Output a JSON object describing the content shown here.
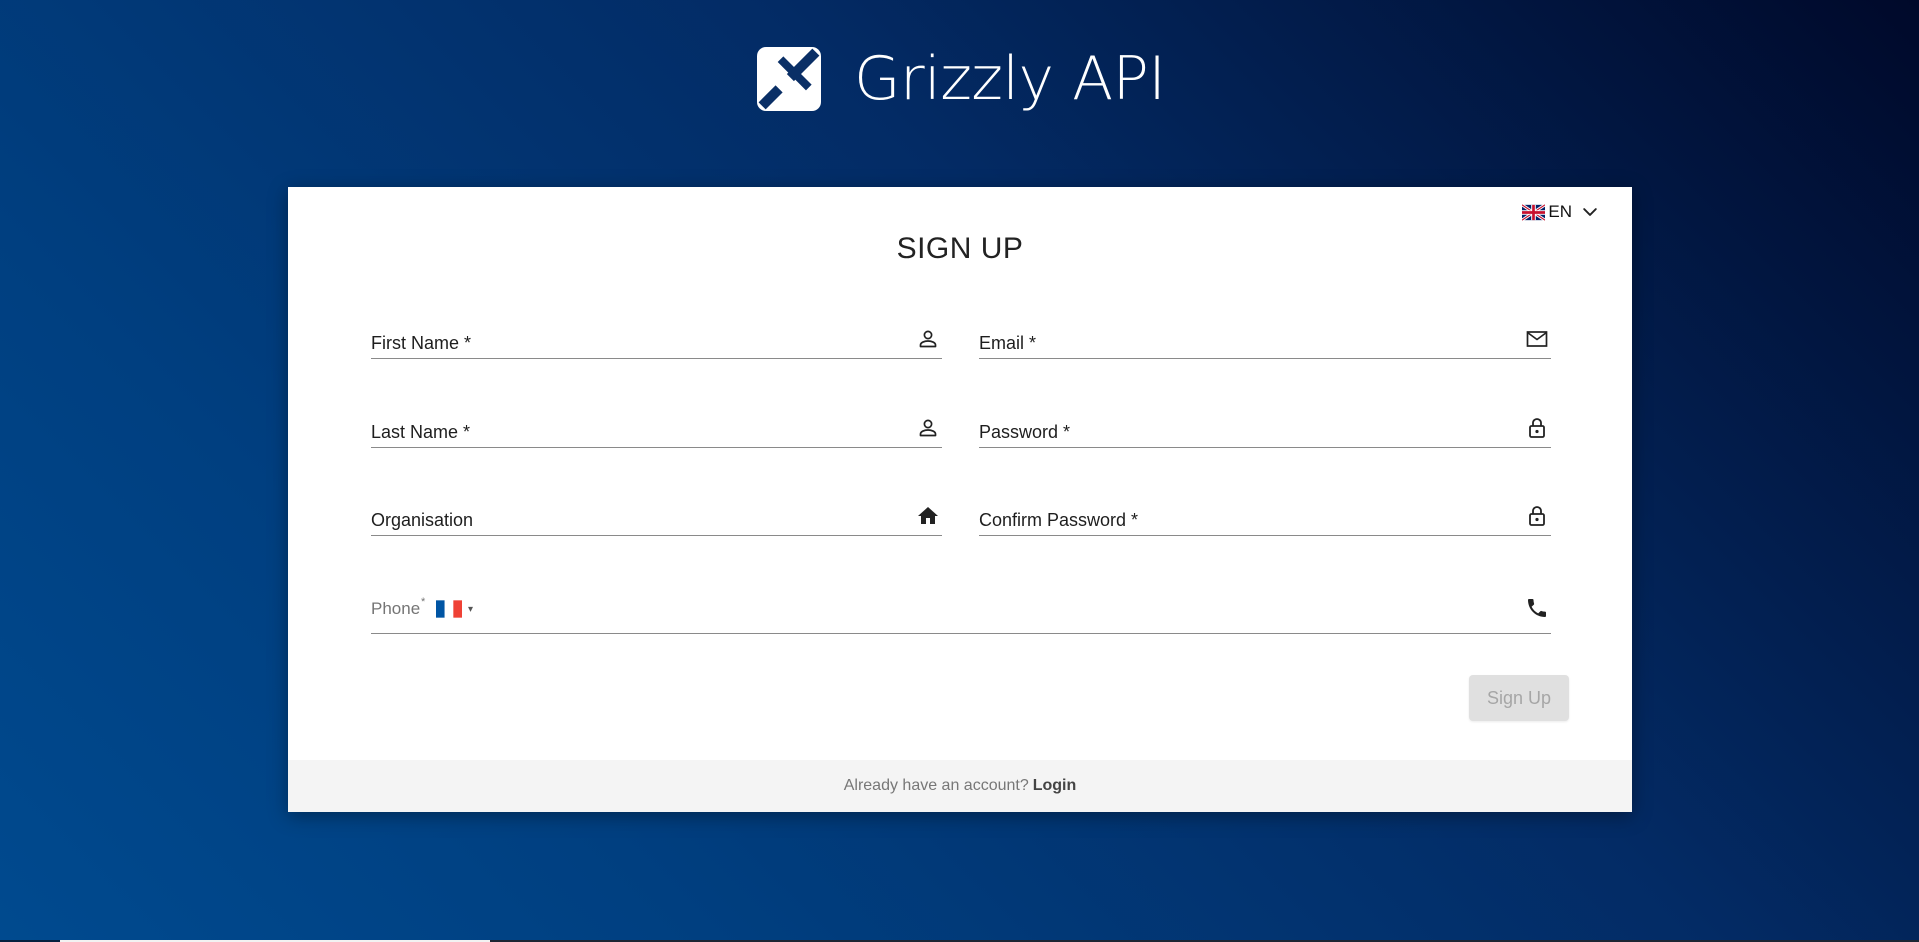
{
  "brand": {
    "name": "Grizzly API",
    "logo_icon": "grizzly-logo-icon"
  },
  "language": {
    "code": "EN",
    "flag_icon": "uk-flag-icon",
    "chevron_icon": "chevron-down-icon"
  },
  "form": {
    "title": "SIGN UP",
    "fields": {
      "first_name": {
        "label": "First Name *",
        "icon": "person-icon"
      },
      "email": {
        "label": "Email *",
        "icon": "envelope-icon"
      },
      "last_name": {
        "label": "Last Name *",
        "icon": "person-icon"
      },
      "password": {
        "label": "Password *",
        "icon": "lock-icon"
      },
      "organisation": {
        "label": "Organisation",
        "icon": "home-icon"
      },
      "confirm_password": {
        "label": "Confirm Password *",
        "icon": "lock-icon"
      },
      "phone": {
        "label": "Phone",
        "required_mark": "*",
        "country_flag_icon": "france-flag-icon",
        "caret": "▾",
        "icon": "phone-icon"
      }
    },
    "submit_label": "Sign Up"
  },
  "footer": {
    "text": "Already have an account?",
    "link_label": "Login"
  },
  "colors": {
    "background_dark": "#00092a",
    "background_light": "#004a8f",
    "card": "#ffffff",
    "footer_bg": "#f4f4f4",
    "disabled_button": "#e0e0e0",
    "disabled_text": "#a6a6a6"
  }
}
